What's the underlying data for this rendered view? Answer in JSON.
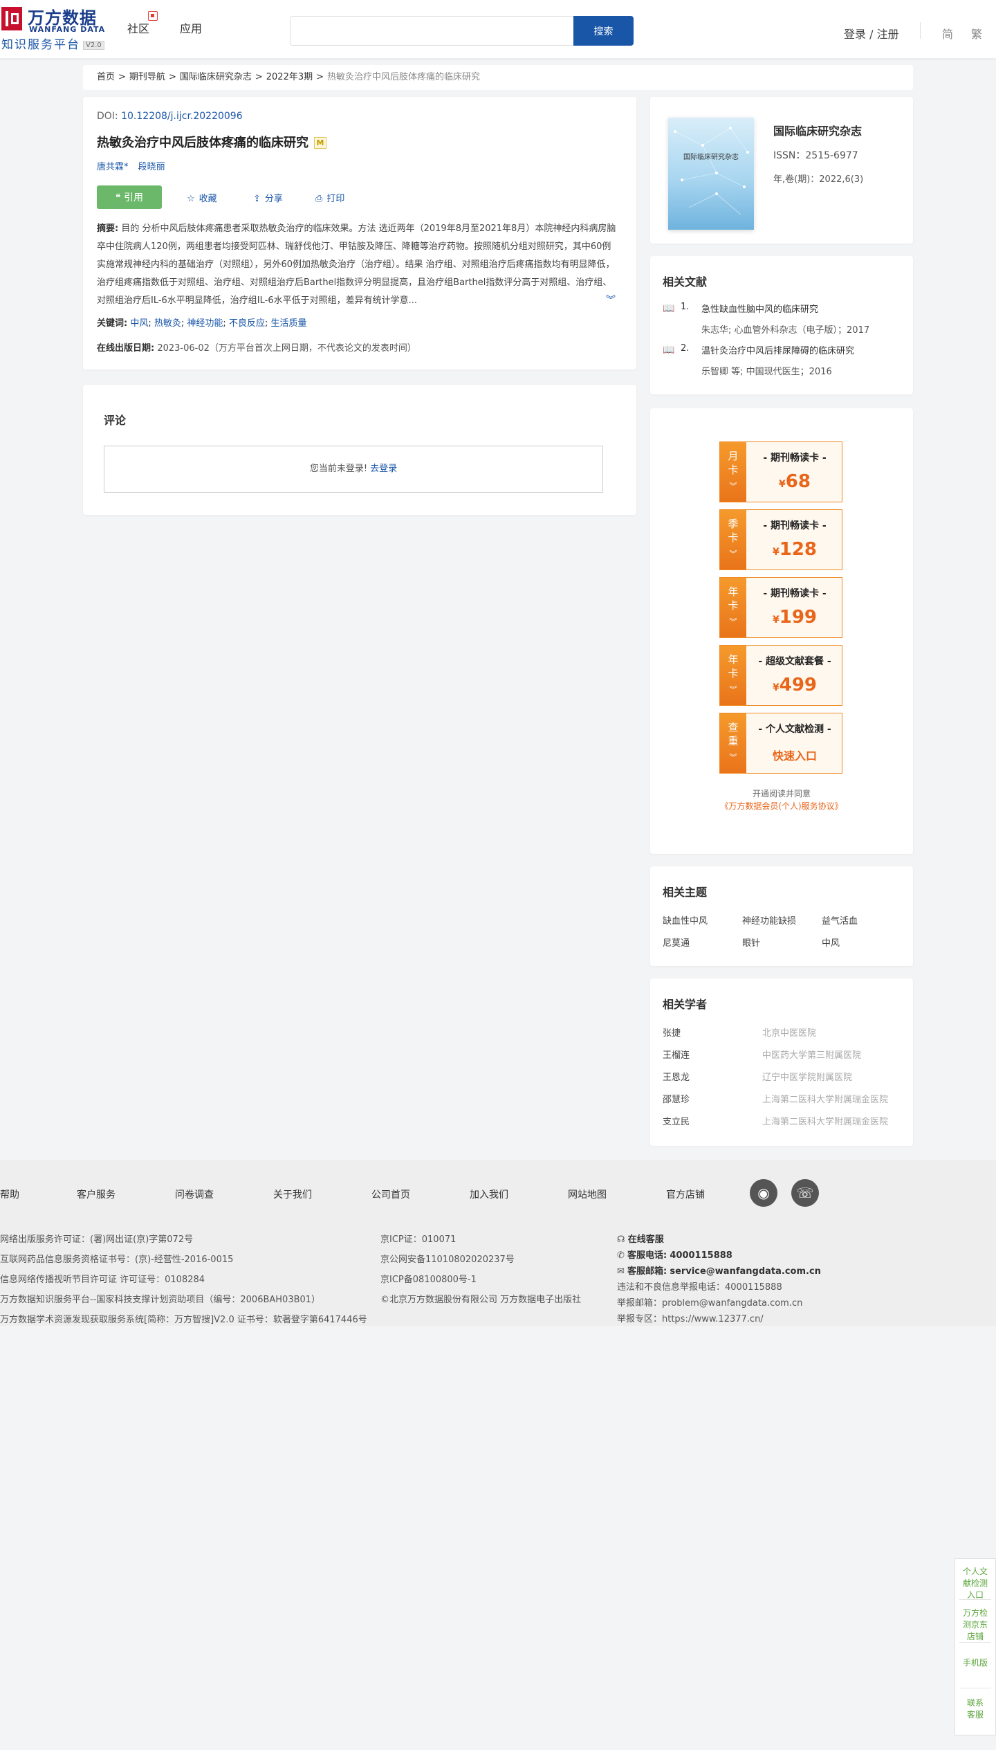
{
  "header": {
    "logo_cn": "万方数据",
    "logo_en": "WANFANG DATA",
    "logo_sub": "知识服务平台",
    "logo_version": "V2.0",
    "nav": [
      "社区",
      "应用"
    ],
    "search_placeholder": "",
    "search_button": "搜索",
    "login": "登录 / 注册",
    "lang_simplified": "简",
    "lang_traditional": "繁"
  },
  "breadcrumb": [
    "首页",
    "期刊导航",
    "国际临床研究杂志",
    "2022年3期",
    "热敏灸治疗中风后肢体疼痛的临床研究"
  ],
  "article": {
    "doi_label": "DOI: ",
    "doi": "10.12208/j.ijcr.20220096",
    "title": "热敏灸治疗中风后肢体疼痛的临床研究",
    "badge": "M",
    "authors": [
      "唐共霖*",
      "段晓丽"
    ],
    "cite_label": "引用",
    "actions": [
      "收藏",
      "分享",
      "打印"
    ],
    "abstract_label": "摘要:",
    "abstract": "目的 分析中风后肢体疼痛患者采取热敏灸治疗的临床效果。方法 选近两年（2019年8月至2021年8月）本院神经内科病房脑卒中住院病人120例，两组患者均接受阿匹林、瑞舒伐他汀、甲钴胺及降压、降糖等治疗药物。按照随机分组对照研究，其中60例实施常规神经内科的基础治疗（对照组），另外60例加热敏灸治疗（治疗组）。结果 治疗组、对照组治疗后疼痛指数均有明显降低，治疗组疼痛指数低于对照组、治疗组、对照组治疗后Barthel指数评分明显提高，且治疗组Barthel指数评分高于对照组、治疗组、对照组治疗后IL-6水平明显降低，治疗组IL-6水平低于对照组，差异有统计学意...",
    "keywords_label": "关键词:",
    "keywords": [
      "中风",
      "热敏灸",
      "神经功能",
      "不良反应",
      "生活质量"
    ],
    "pubdate_label": "在线出版日期:",
    "pubdate": "2023-06-02（万方平台首次上网日期，不代表论文的发表时间）"
  },
  "comments": {
    "title": "评论",
    "notice": "您当前未登录!",
    "login_link": "去登录"
  },
  "journal": {
    "cover_text": "国际临床研究杂志",
    "name": "国际临床研究杂志",
    "issn": "ISSN：2515-6977",
    "volume": "年,卷(期)：2022,6(3)"
  },
  "related": {
    "title": "相关文献",
    "items": [
      {
        "num": "1.",
        "title": "急性缺血性脑中风的临床研究",
        "meta_authors": "朱志华;",
        "meta_source": "心血管外科杂志（电子版）；2017"
      },
      {
        "num": "2.",
        "title": "温针灸治疗中风后排尿障碍的临床研究",
        "meta_authors": "乐智卿  等;",
        "meta_source": "中国现代医生；2016"
      }
    ]
  },
  "vip_cards": [
    {
      "tag": "月卡",
      "name": "- 期刊畅读卡 -",
      "currency": "¥",
      "price": "68"
    },
    {
      "tag": "季卡",
      "name": "- 期刊畅读卡 -",
      "currency": "¥",
      "price": "128"
    },
    {
      "tag": "年卡",
      "name": "- 期刊畅读卡 -",
      "currency": "¥",
      "price": "199"
    },
    {
      "tag": "年卡",
      "name": "- 超级文献套餐 -",
      "currency": "¥",
      "price": "499"
    },
    {
      "tag": "查重",
      "name": "- 个人文献检测 -",
      "link": "快速入口"
    }
  ],
  "agreement": {
    "text": "开通阅读并同意",
    "link": "《万方数据会员(个人)服务协议》"
  },
  "topics": {
    "title": "相关主题",
    "items": [
      "缺血性中风",
      "神经功能缺损",
      "益气活血",
      "尼莫通",
      "眼针",
      "中风"
    ]
  },
  "scholars": {
    "title": "相关学者",
    "items": [
      {
        "name": "张捷",
        "org": "北京中医医院"
      },
      {
        "name": "王榴连",
        "org": "中医药大学第三附属医院"
      },
      {
        "name": "王恩龙",
        "org": "辽宁中医学院附属医院"
      },
      {
        "name": "邵慧珍",
        "org": "上海第二医科大学附属瑞金医院"
      },
      {
        "name": "支立民",
        "org": "上海第二医科大学附属瑞金医院"
      }
    ]
  },
  "footer": {
    "nav": [
      "帮助",
      "客户服务",
      "问卷调查",
      "关于我们",
      "公司首页",
      "加入我们",
      "网站地图",
      "官方店铺"
    ],
    "col1": [
      "网络出版服务许可证：(署)网出证(京)字第072号",
      "互联网药品信息服务资格证书号：(京)-经营性-2016-0015",
      "信息网络传播视听节目许可证 许可证号：0108284",
      "万方数据知识服务平台--国家科技支撑计划资助项目（编号：2006BAH03B01）",
      "万方数据学术资源发现获取服务系统[简称：万方智搜]V2.0 证书号：软著登字第6417446号"
    ],
    "col2": [
      "京ICP证：010071",
      "京公网安备11010802020237号",
      "京ICP备08100800号-1",
      "©北京万方数据股份有限公司 万方数据电子出版社"
    ],
    "online_service": "在线客服",
    "phone_label": "客服电话:",
    "phone": "4000115888",
    "email_label": "客服邮箱:",
    "email": "service@wanfangdata.com.cn",
    "report_phone": "违法和不良信息举报电话：4000115888",
    "report_email": "举报邮箱：problem@wanfangdata.com.cn",
    "report_area": "举报专区：https://www.12377.cn/"
  },
  "float_bar": [
    "个人文献检测入口",
    "万方检测京东店铺",
    "手机版",
    "联系客服"
  ]
}
